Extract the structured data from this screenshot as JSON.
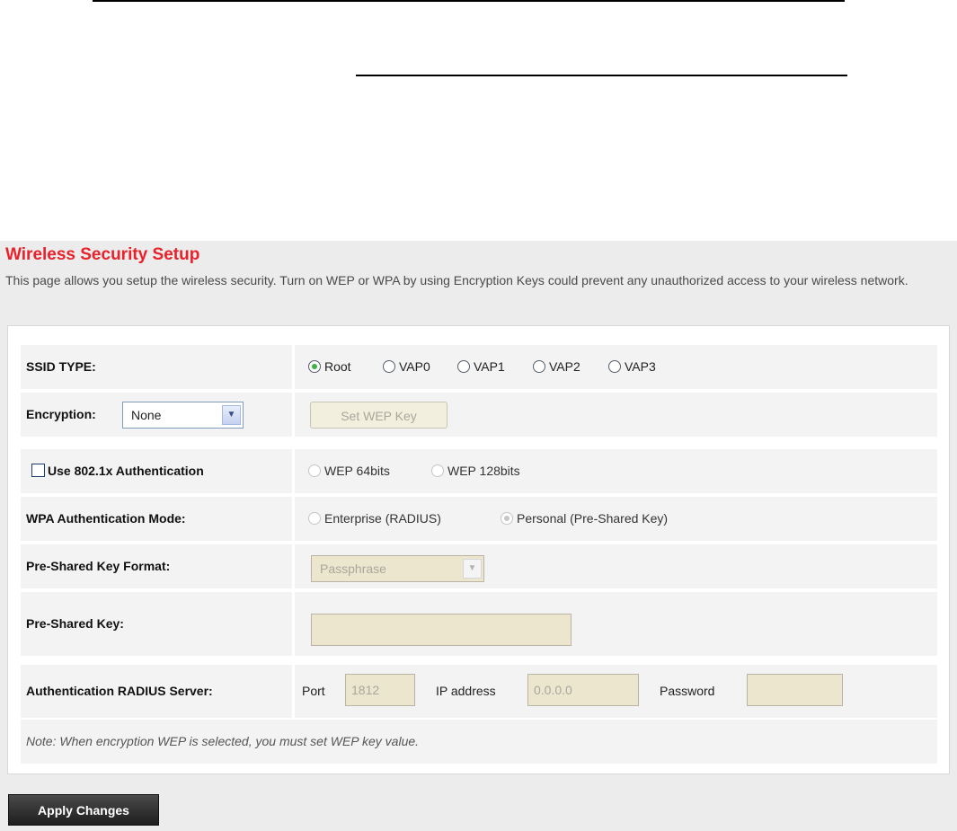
{
  "header": {
    "title": "Wireless Security Setup",
    "description": "This page allows you setup the wireless security. Turn on WEP or WPA by using Encryption Keys could prevent any unauthorized access to your wireless network."
  },
  "ssid_type": {
    "label": "SSID TYPE:",
    "options": [
      "Root",
      "VAP0",
      "VAP1",
      "VAP2",
      "VAP3"
    ],
    "selected": "Root"
  },
  "encryption": {
    "label": "Encryption:",
    "value": "None",
    "set_wep_key_label": "Set WEP Key"
  },
  "auth_8021x": {
    "label": "Use 802.1x Authentication",
    "checked": false,
    "options": [
      "WEP 64bits",
      "WEP 128bits"
    ]
  },
  "wpa_mode": {
    "label": "WPA Authentication Mode:",
    "options": [
      "Enterprise (RADIUS)",
      "Personal (Pre-Shared Key)"
    ],
    "selected": "Personal (Pre-Shared Key)"
  },
  "psk_format": {
    "label": "Pre-Shared Key Format:",
    "value": "Passphrase"
  },
  "psk": {
    "label": "Pre-Shared Key:",
    "value": ""
  },
  "radius": {
    "label": "Authentication RADIUS Server:",
    "port_label": "Port",
    "port_value": "1812",
    "ip_label": "IP address",
    "ip_value": "0.0.0.0",
    "password_label": "Password",
    "password_value": ""
  },
  "note": "Note: When encryption WEP is selected, you must set WEP key value.",
  "apply_label": "Apply Changes",
  "colors": {
    "title": "#e8212a",
    "panel_bg": "#ececec",
    "disabled_field": "#ece6cf",
    "radio_selected": "#3bb243"
  }
}
